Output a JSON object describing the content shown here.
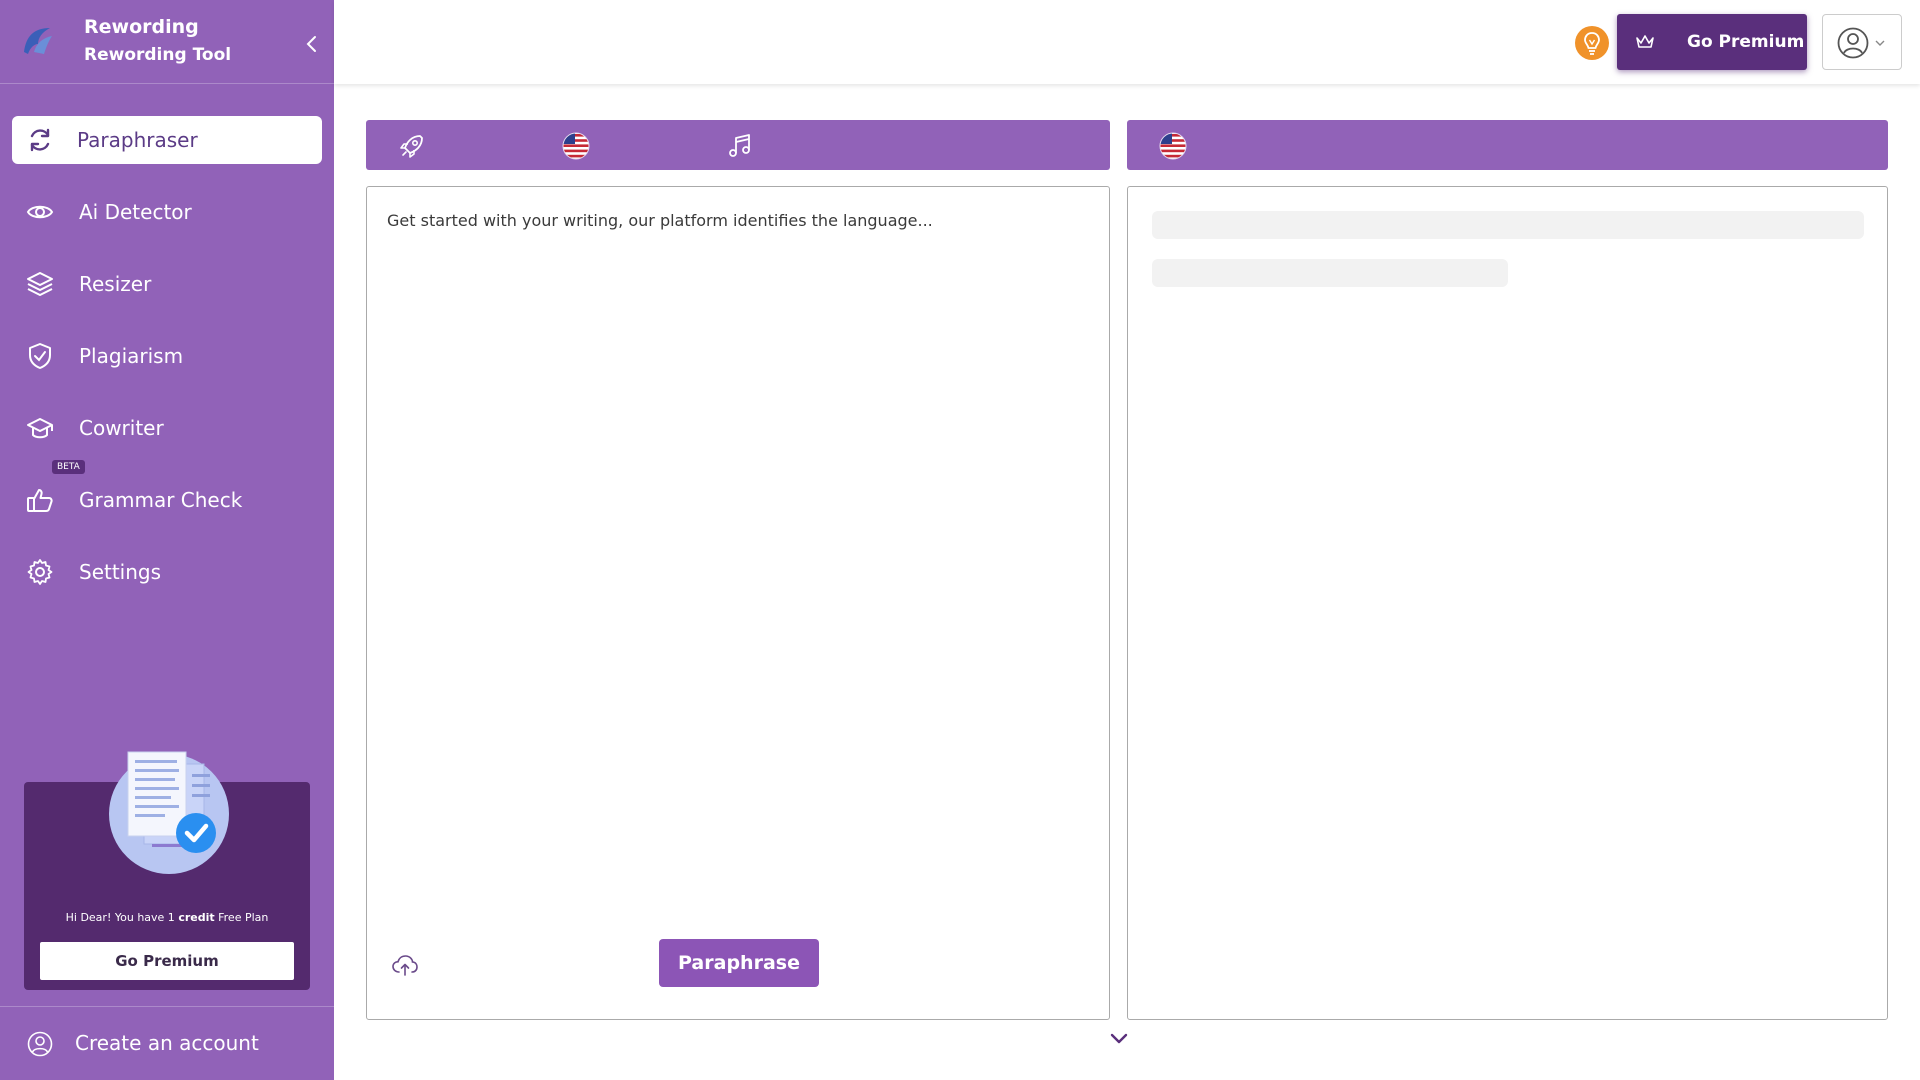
{
  "brand": {
    "name": "Rewording",
    "subtitle": "Rewording Tool"
  },
  "sidebar": {
    "items": [
      {
        "label": "Paraphraser",
        "icon": "refresh-icon",
        "active": true
      },
      {
        "label": "Ai Detector",
        "icon": "eye-icon"
      },
      {
        "label": "Resizer",
        "icon": "layers-icon"
      },
      {
        "label": "Plagiarism",
        "icon": "shield-check-icon"
      },
      {
        "label": "Cowriter",
        "icon": "graduation-cap-icon"
      },
      {
        "label": "Grammar Check",
        "icon": "thumbs-up-icon",
        "badge": "BETA"
      },
      {
        "label": "Settings",
        "icon": "gear-icon"
      }
    ],
    "promo": {
      "text_prefix": "Hi Dear! You have 1",
      "text_bold": "credit",
      "text_suffix": "Free Plan",
      "button_label": "Go Premium"
    },
    "footer": {
      "label": "Create an account"
    }
  },
  "header": {
    "premium_label": "Go Premium"
  },
  "editor": {
    "placeholder": "Get started with your writing, our platform identifies the language...",
    "action_label": "Paraphrase"
  },
  "colors": {
    "sidebar": "#9162b8",
    "dark_purple": "#5a2f7c",
    "accent_orange": "#f0922a",
    "button_purple": "#8c55b6"
  }
}
